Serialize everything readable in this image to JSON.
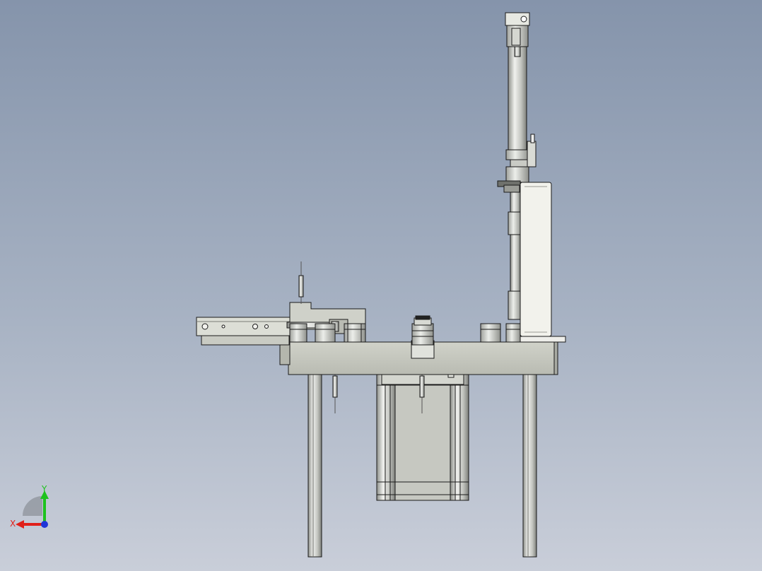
{
  "viewport": {
    "background_top": "#8594ab",
    "background_bottom": "#c9ced9"
  },
  "triad": {
    "x_label": "X",
    "y_label": "Y",
    "x_color": "#e0201a",
    "y_color": "#1dc21d",
    "z_color": "#2036d8"
  },
  "model": {
    "edge_color": "#1a1a1a",
    "metal_light": "#e4e6e2",
    "metal_mid": "#c9cbc5",
    "metal_dark": "#9a9c97",
    "plate_color": "#c4c6bd",
    "panel_color": "#f2f2ec"
  }
}
